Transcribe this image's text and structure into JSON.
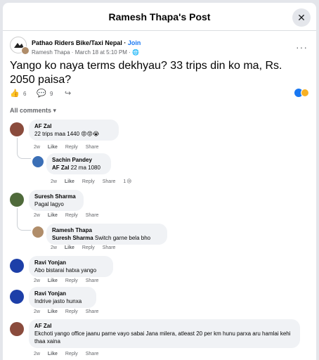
{
  "header": {
    "title": "Ramesh Thapa's Post",
    "close_icon": "close-icon"
  },
  "post": {
    "group_name": "Pathao Riders Bike/Taxi Nepal",
    "join_label": "Join",
    "author": "Ramesh Thapa",
    "date": "March 18 at 5:10 PM",
    "text": "Yango ko naya terms dekhyau? 33 trips din ko ma, Rs. 2050 paisa?",
    "likes": "6",
    "comments": "9"
  },
  "all_comments_label": "All comments",
  "action_labels": {
    "like": "Like",
    "reply": "Reply",
    "share": "Share"
  },
  "comments": [
    {
      "author": "AF Zal",
      "text": "22 trips maa 1440 😡😡😭",
      "time": "2w"
    },
    {
      "author": "Sachin Pandey",
      "mention": "AF Zal",
      "text": " 22 ma 1080",
      "time": "2w",
      "reaction_count": "1"
    },
    {
      "author": "Suresh Sharma",
      "text": "Pagal lagyo",
      "time": "2w"
    },
    {
      "author": "Ramesh Thapa",
      "mention": "Suresh Sharma",
      "text": " Switch garne bela bho",
      "time": "2w"
    },
    {
      "author": "Ravi Yonjan",
      "text": "Abo bistarai hatxa yango",
      "time": "2w"
    },
    {
      "author": "Ravi Yonjan",
      "text": "Indrive jasto hunxa",
      "time": "2w"
    },
    {
      "author": "AF Zal",
      "text": "Ekchoti yango office jaanu parne vayo sabai Jana milera, atleast 20 per km hunu parxa aru hamlai kehi thaa xaina",
      "time": "2w"
    }
  ]
}
